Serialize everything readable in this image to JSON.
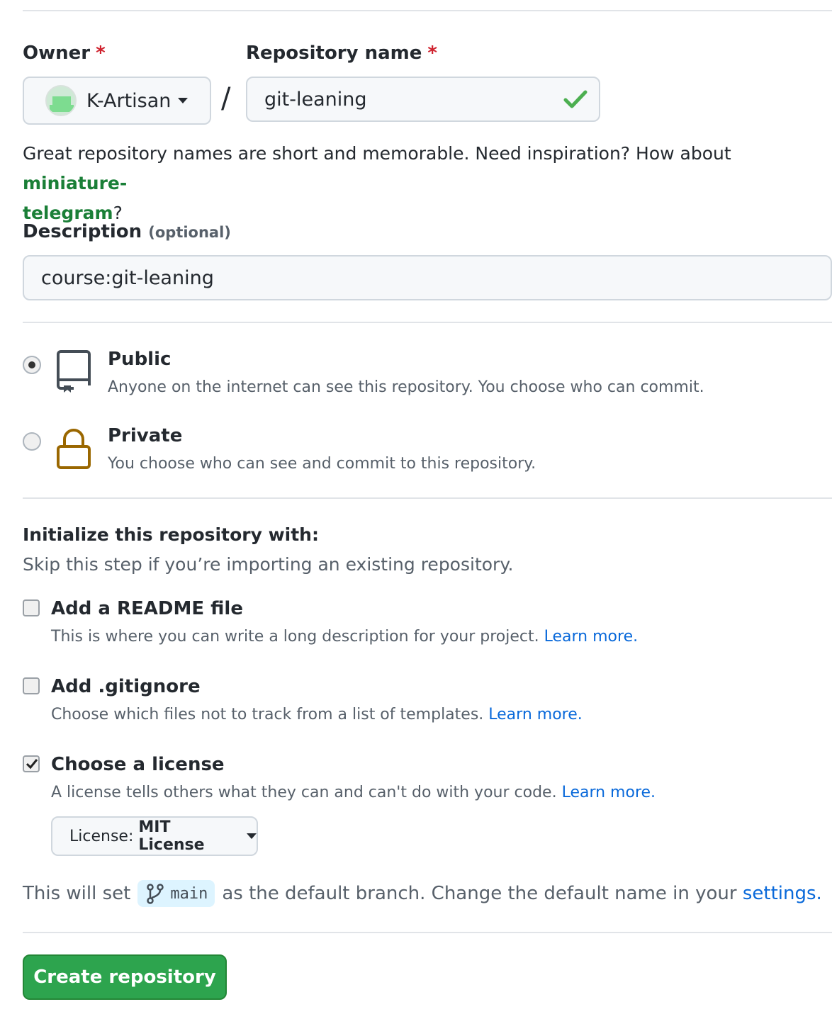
{
  "owner": {
    "label": "Owner",
    "required_mark": "*",
    "value": "K-Artisan"
  },
  "repo": {
    "label": "Repository name",
    "required_mark": "*",
    "value": "git-leaning",
    "separator": "/"
  },
  "hint": {
    "text": "Great repository names are short and memorable. Need inspiration? How about ",
    "suggestion_a": "miniature-",
    "suggestion_b": "telegram",
    "end": "?"
  },
  "description": {
    "label": "Description",
    "optional": "(optional)",
    "value": "course:git-leaning"
  },
  "visibility": {
    "selected": "Public",
    "public": {
      "title": "Public",
      "desc": "Anyone on the internet can see this repository. You choose who can commit."
    },
    "private": {
      "title": "Private",
      "desc": "You choose who can see and commit to this repository."
    }
  },
  "init": {
    "title": "Initialize this repository with:",
    "subtitle": "Skip this step if you’re importing an existing repository.",
    "readme": {
      "label": "Add a README file",
      "desc": "This is where you can write a long description for your project.",
      "link": "Learn more.",
      "checked": false
    },
    "gitignore": {
      "label": "Add .gitignore",
      "desc": "Choose which files not to track from a list of templates.",
      "link": "Learn more.",
      "checked": false
    },
    "license": {
      "label": "Choose a license",
      "desc": "A license tells others what they can and can't do with your code.",
      "link": "Learn more.",
      "checked": true,
      "select_prefix": "License:",
      "select_value": "MIT License"
    }
  },
  "branch": {
    "pre": "This will set",
    "name": "main",
    "post": "as the default branch. Change the default name in your",
    "link": "settings",
    "end": "."
  },
  "submit": {
    "label": "Create repository"
  },
  "colors": {
    "green_button": "#2da44e",
    "link_blue": "#0969da",
    "suggest_green": "#1a7f37",
    "check_green": "#4caf50"
  },
  "icons": [
    "avatar",
    "chevron-down-icon",
    "check-icon",
    "repo-icon",
    "lock-icon",
    "git-branch-icon"
  ]
}
